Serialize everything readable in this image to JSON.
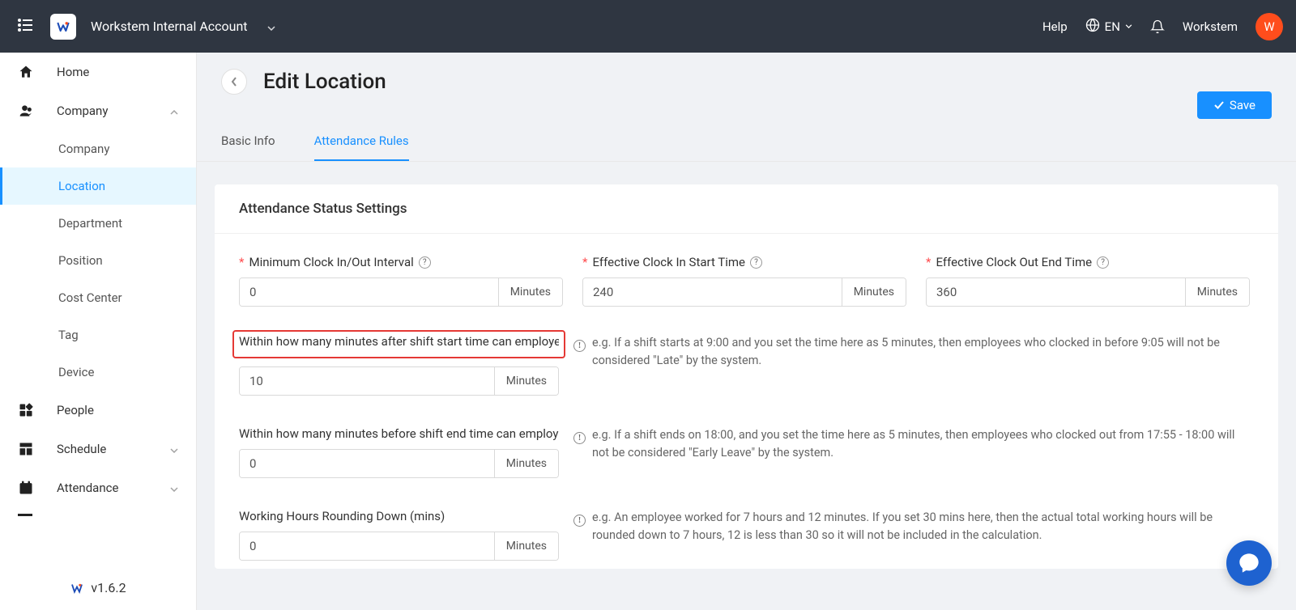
{
  "header": {
    "account_name": "Workstem Internal Account",
    "help": "Help",
    "lang": "EN",
    "user": "Workstem",
    "avatar_letter": "W"
  },
  "sidebar": {
    "items": [
      {
        "label": "Home"
      },
      {
        "label": "Company"
      },
      {
        "label": "Company"
      },
      {
        "label": "Location"
      },
      {
        "label": "Department"
      },
      {
        "label": "Position"
      },
      {
        "label": "Cost Center"
      },
      {
        "label": "Tag"
      },
      {
        "label": "Device"
      },
      {
        "label": "People"
      },
      {
        "label": "Schedule"
      },
      {
        "label": "Attendance"
      }
    ],
    "version": "v1.6.2"
  },
  "page": {
    "title": "Edit Location",
    "save": "Save",
    "tabs": {
      "basic": "Basic Info",
      "attendance": "Attendance Rules"
    },
    "card_title": "Attendance Status Settings",
    "unit_minutes": "Minutes",
    "fields": {
      "min_interval": {
        "label": "Minimum Clock In/Out Interval",
        "value": "0"
      },
      "eff_in": {
        "label": "Effective Clock In Start Time",
        "value": "240"
      },
      "eff_out": {
        "label": "Effective Clock Out End Time",
        "value": "360"
      },
      "late_grace": {
        "label": "Within how many minutes after shift start time can employees",
        "value": "10"
      },
      "early_grace": {
        "label": "Within how many minutes before shift end time can employees",
        "value": "0"
      },
      "round_down": {
        "label": "Working Hours Rounding Down (mins)",
        "value": "0"
      }
    },
    "hints": {
      "late": "e.g. If a shift starts at 9:00 and you set the time here as 5 minutes, then employees who clocked in before 9:05 will not be considered \"Late\" by the system.",
      "early": "e.g. If a shift ends on 18:00, and you set the time here as 5 minutes, then employees who clocked out from 17:55 - 18:00 will not be considered \"Early Leave\" by the system.",
      "round": "e.g. An employee worked for 7 hours and 12 minutes. If you set 30 mins here, then the actual total working hours will be rounded down to 7 hours, 12 is less than 30 so it will not be included in the calculation."
    }
  }
}
